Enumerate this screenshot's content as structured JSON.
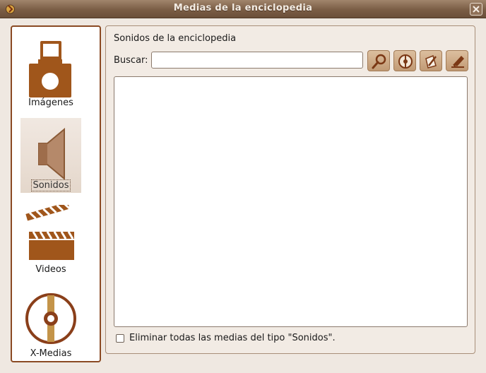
{
  "window": {
    "title": "Medias de la enciclopedia"
  },
  "sidebar": {
    "items": [
      {
        "label": "Imágenes",
        "icon": "camera-icon",
        "selected": false
      },
      {
        "label": "Sonidos",
        "icon": "speaker-icon",
        "selected": true
      },
      {
        "label": "Videos",
        "icon": "clapperboard-icon",
        "selected": false
      },
      {
        "label": "X-Medias",
        "icon": "disc-icon",
        "selected": false
      }
    ]
  },
  "main": {
    "section_title": "Sonidos de la enciclopedia",
    "search": {
      "label": "Buscar:",
      "value": "",
      "placeholder": ""
    },
    "toolbar": [
      "magnifier-icon",
      "play-disc-icon",
      "edit-icon",
      "eraser-icon"
    ],
    "list_items": [],
    "delete_all": {
      "label": "Eliminar todas las medias del tipo \"Sonidos\".",
      "checked": false
    }
  },
  "colors": {
    "accent": "#8a4a23",
    "brown": "#a0561b",
    "titlebar": "#7a5d45"
  }
}
